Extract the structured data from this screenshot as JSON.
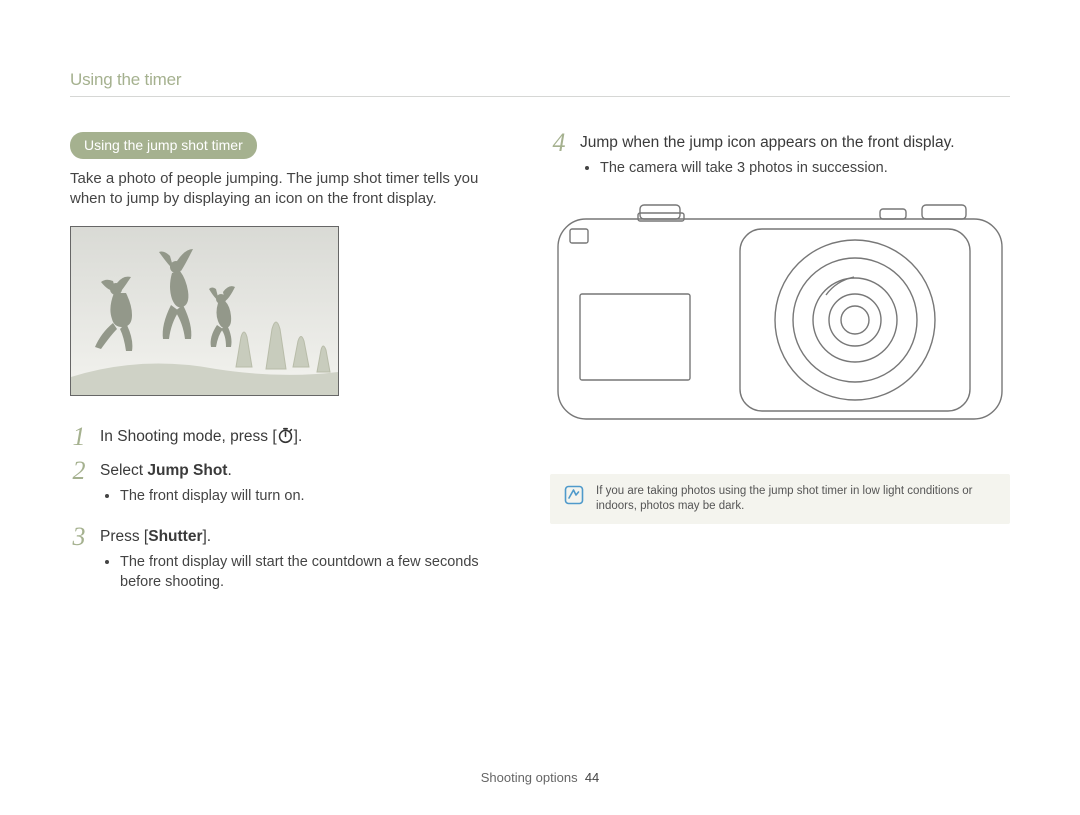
{
  "header": {
    "title": "Using the timer"
  },
  "left": {
    "pill": "Using the jump shot timer",
    "intro": "Take a photo of people jumping. The jump shot timer tells you when to jump by displaying an icon on the front display.",
    "steps": {
      "s1_num": "1",
      "s1_pre": "In Shooting mode, press [",
      "s1_post": "].",
      "s2_num": "2",
      "s2_text_a": "Select ",
      "s2_text_b": "Jump Shot",
      "s2_text_c": ".",
      "s2_bullet": "The front display will turn on.",
      "s3_num": "3",
      "s3_text_a": "Press [",
      "s3_text_b": "Shutter",
      "s3_text_c": "].",
      "s3_bullet": "The front display will start the countdown a few seconds before shooting."
    }
  },
  "right": {
    "s4_num": "4",
    "s4_text": "Jump when the jump icon appears on the front display.",
    "s4_bullet": "The camera will take 3 photos in succession.",
    "note": "If you are taking photos using the jump shot timer in low light conditions or indoors, photos may be dark."
  },
  "footer": {
    "section": "Shooting options",
    "page": "44"
  }
}
